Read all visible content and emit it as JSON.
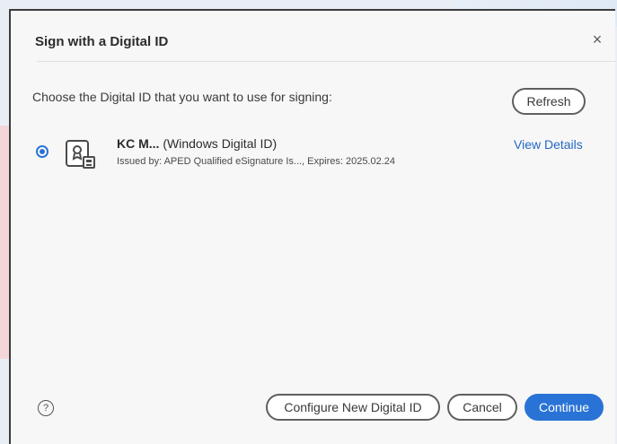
{
  "dialog": {
    "title": "Sign with a Digital ID",
    "close_label": "×",
    "prompt": "Choose the Digital ID that you want to use for signing:",
    "refresh_label": "Refresh",
    "digital_id": {
      "name": "KC M...",
      "type": "(Windows Digital ID)",
      "details": "Issued by: APED Qualified eSignature Is..., Expires: 2025.02.24",
      "selected": true
    },
    "view_details_label": "View Details",
    "help_label": "?",
    "configure_label": "Configure New Digital ID",
    "cancel_label": "Cancel",
    "continue_label": "Continue"
  },
  "colors": {
    "accent": "#2a73d6",
    "link": "#2468c6"
  },
  "icons": {
    "close": "close-icon",
    "certificate": "certificate-icon",
    "help": "help-icon"
  }
}
